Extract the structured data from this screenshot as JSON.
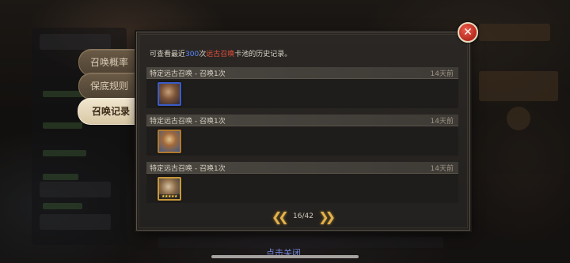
{
  "tabs": [
    {
      "label": "召唤概率",
      "active": false
    },
    {
      "label": "保底规则",
      "active": false
    },
    {
      "label": "召唤记录",
      "active": true
    }
  ],
  "panel": {
    "intro": {
      "prefix": "可查看最近",
      "count": "300",
      "mid": "次",
      "pool": "远古召唤",
      "suffix": "卡池的历史记录。"
    },
    "records": [
      {
        "title": "特定远古召唤 - 召唤1次",
        "time": "14天前",
        "hero_icon": "hero-portrait-icon"
      },
      {
        "title": "特定远古召唤 - 召唤1次",
        "time": "14天前",
        "hero_icon": "hero-portrait-icon"
      },
      {
        "title": "特定远古召唤 - 召唤1次",
        "time": "14天前",
        "hero_icon": "hero-portrait-icon"
      }
    ],
    "pager": {
      "page": "16/42"
    }
  },
  "close_hint": "点击关闭",
  "colors": {
    "accent_gold": "#e4b24a",
    "count_blue": "#5b86ff",
    "pool_red": "#e8503c",
    "close_red": "#d63a2a"
  }
}
